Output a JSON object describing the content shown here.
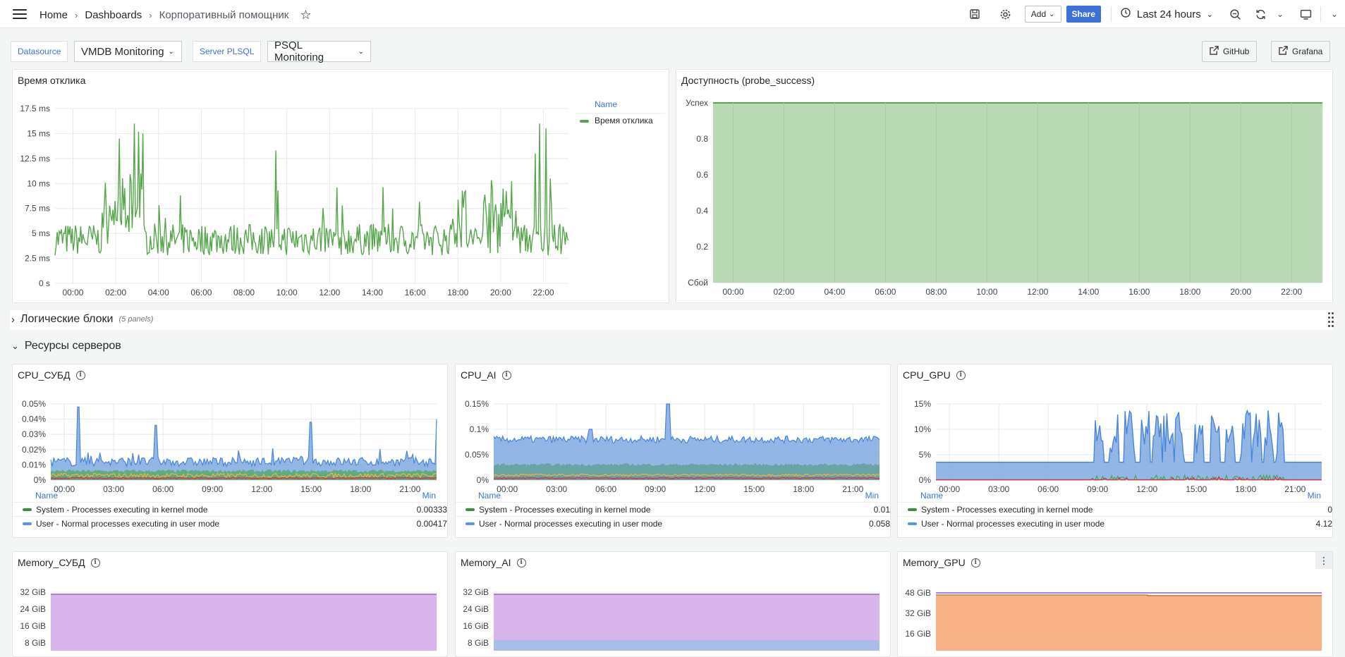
{
  "topbar": {
    "breadcrumbs": [
      "Home",
      "Dashboards",
      "Корпоративный помощник"
    ],
    "add_label": "Add",
    "share_label": "Share",
    "time_range": "Last 24 hours"
  },
  "variables": [
    {
      "label": "Datasource",
      "value": "VMDB Monitoring"
    },
    {
      "label": "Server PLSQL",
      "value": "PSQL Monitoring"
    }
  ],
  "links": [
    "GitHub",
    "Grafana"
  ],
  "colors": {
    "green": "#56a64b",
    "green_fill": "#bcdcb8",
    "blue": "#5794f2",
    "blue_fill": "#7fa9e0",
    "orange": "#f2a56b",
    "purple_fill": "#d7b4e8",
    "link": "#3d71d9"
  },
  "rows": [
    {
      "title": "Логические блоки",
      "count": "(5 panels)",
      "collapsed": true
    },
    {
      "title": "Ресурсы серверов",
      "collapsed": false
    }
  ],
  "panels": {
    "response": {
      "title": "Время отклика",
      "legend_header": "Name",
      "series_name": "Время отклика",
      "y_ticks": [
        "17.5 ms",
        "15 ms",
        "12.5 ms",
        "10 ms",
        "7.5 ms",
        "5 ms",
        "2.5 ms",
        "0 s"
      ],
      "x_ticks": [
        "00:00",
        "02:00",
        "04:00",
        "06:00",
        "08:00",
        "10:00",
        "12:00",
        "14:00",
        "16:00",
        "18:00",
        "20:00",
        "22:00"
      ]
    },
    "availability": {
      "title": "Доступность (probe_success)",
      "y_ticks": [
        "Успех",
        "0.8",
        "0.6",
        "0.4",
        "0.2",
        "Сбой"
      ],
      "x_ticks": [
        "00:00",
        "02:00",
        "04:00",
        "06:00",
        "08:00",
        "10:00",
        "12:00",
        "14:00",
        "16:00",
        "18:00",
        "20:00",
        "22:00"
      ]
    },
    "cpu": [
      {
        "title": "CPU_СУБД",
        "y_ticks": [
          "0.05%",
          "0.04%",
          "0.03%",
          "0.02%",
          "0.01%",
          "0%"
        ],
        "x_ticks": [
          "00:00",
          "03:00",
          "06:00",
          "09:00",
          "12:00",
          "15:00",
          "18:00",
          "21:00"
        ],
        "legend": {
          "name": "Name",
          "stat": "Min",
          "rows": [
            {
              "label": "System - Processes executing in kernel mode",
              "value": "0.00333"
            },
            {
              "label": "User - Normal processes executing in user mode",
              "value": "0.00417"
            }
          ]
        }
      },
      {
        "title": "CPU_AI",
        "y_ticks": [
          "0.15%",
          "0.1%",
          "0.05%",
          "0%"
        ],
        "x_ticks": [
          "00:00",
          "03:00",
          "06:00",
          "09:00",
          "12:00",
          "15:00",
          "18:00",
          "21:00"
        ],
        "legend": {
          "name": "Name",
          "stat": "Min",
          "rows": [
            {
              "label": "System - Processes executing in kernel mode",
              "value": "0.01"
            },
            {
              "label": "User - Normal processes executing in user mode",
              "value": "0.058"
            }
          ]
        }
      },
      {
        "title": "CPU_GPU",
        "y_ticks": [
          "15%",
          "10%",
          "5%",
          "0%"
        ],
        "x_ticks": [
          "00:00",
          "03:00",
          "06:00",
          "09:00",
          "12:00",
          "15:00",
          "18:00",
          "21:00"
        ],
        "legend": {
          "name": "Name",
          "stat": "Min",
          "rows": [
            {
              "label": "System - Processes executing in kernel mode",
              "value": "0"
            },
            {
              "label": "User - Normal processes executing in user mode",
              "value": "4.12"
            }
          ]
        }
      }
    ],
    "memory": [
      {
        "title": "Memory_СУБД",
        "y_ticks": [
          "32 GiB",
          "24 GiB",
          "16 GiB",
          "8 GiB"
        ]
      },
      {
        "title": "Memory_AI",
        "y_ticks": [
          "32 GiB",
          "24 GiB",
          "16 GiB",
          "8 GiB"
        ]
      },
      {
        "title": "Memory_GPU",
        "y_ticks": [
          "48 GiB",
          "32 GiB",
          "16 GiB"
        ]
      }
    ]
  }
}
